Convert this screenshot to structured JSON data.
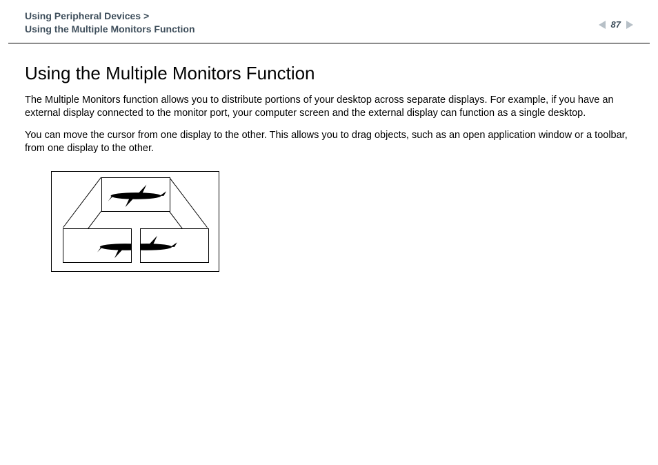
{
  "header": {
    "breadcrumb_line1": "Using Peripheral Devices",
    "breadcrumb_line2": "Using the Multiple Monitors Function",
    "page_number": "87"
  },
  "content": {
    "title": "Using the Multiple Monitors Function",
    "para1": "The Multiple Monitors function allows you to distribute portions of your desktop across separate displays. For example, if you have an external display connected to the monitor port, your computer screen and the external display can function as a single desktop.",
    "para2": "You can move the cursor from one display to the other. This allows you to drag objects, such as an open application window or a toolbar, from one display to the other."
  }
}
